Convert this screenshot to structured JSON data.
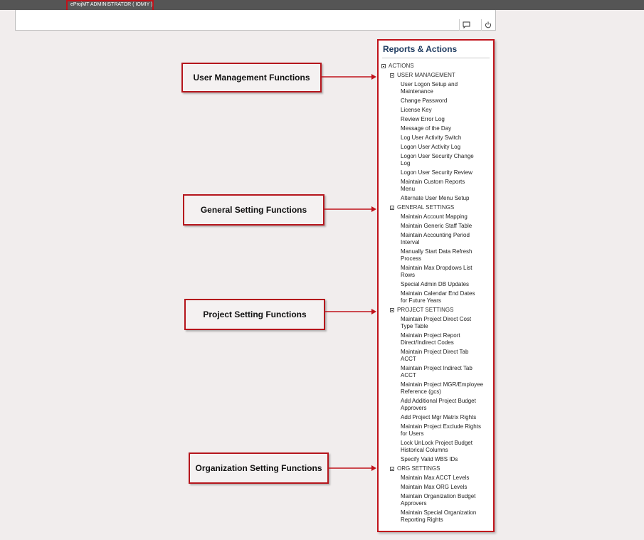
{
  "header": {
    "user_label": "eProjMT ADMINISTRATOR ( IOMIY )",
    "icons": [
      "chat-icon",
      "power-icon"
    ]
  },
  "callouts": [
    {
      "id": "user-management",
      "label": "User Management Functions"
    },
    {
      "id": "general-setting",
      "label": "General Setting Functions"
    },
    {
      "id": "project-setting",
      "label": "Project Setting Functions"
    },
    {
      "id": "organization-setting",
      "label": "Organization Setting Functions"
    }
  ],
  "panel": {
    "title": "Reports & Actions",
    "root": "ACTIONS",
    "sections": [
      {
        "label": "USER MANAGEMENT",
        "items": [
          [
            "User Logon Setup and",
            "Maintenance"
          ],
          [
            "Change Password"
          ],
          [
            "License Key"
          ],
          [
            "Review Error Log"
          ],
          [
            "Message of the Day"
          ],
          [
            "Log User Activity Switch"
          ],
          [
            "Logon User Activity Log"
          ],
          [
            "Logon User Security Change",
            "Log"
          ],
          [
            "Logon User Security Review"
          ],
          [
            "Maintain Custom Reports",
            "Menu"
          ],
          [
            "Alternate User Menu Setup"
          ]
        ]
      },
      {
        "label": "GENERAL SETTINGS",
        "items": [
          [
            "Maintain Account Mapping"
          ],
          [
            "Maintain Generic Staff Table"
          ],
          [
            "Maintain Accounting Period",
            "Interval"
          ],
          [
            "Manually Start Data Refresh",
            "Process"
          ],
          [
            "Maintain Max Dropdows List",
            "Rows"
          ],
          [
            "Special Admin DB Updates"
          ],
          [
            "Maintain Calendar End Dates",
            "for Future Years"
          ]
        ]
      },
      {
        "label": "PROJECT SETTINGS",
        "items": [
          [
            "Maintain Project Direct Cost",
            "Type Table"
          ],
          [
            "Maintain Project Report",
            "Direct/Indirect Codes"
          ],
          [
            "Maintain Project Direct Tab",
            "ACCT"
          ],
          [
            "Maintain Project Indirect Tab",
            "ACCT"
          ],
          [
            "Maintain Project MGR/Employee",
            "Reference (gcs)"
          ],
          [
            "Add Additional Project Budget",
            "Approvers"
          ],
          [
            "Add Project Mgr Matrix Rights"
          ],
          [
            "Maintain Project Exclude Rights",
            "for Users"
          ],
          [
            "Lock UnLock Project Budget",
            "Historical Columns"
          ],
          [
            "Specify Valid WBS IDs"
          ]
        ]
      },
      {
        "label": "ORG SETTINGS",
        "items": [
          [
            "Maintain Max ACCT Levels"
          ],
          [
            "Maintain Max ORG Levels"
          ],
          [
            "Maintain Organization Budget",
            "Approvers"
          ],
          [
            "Maintain Special Organization",
            "Reporting Rights"
          ]
        ]
      }
    ]
  },
  "colors": {
    "highlight_border": "#c0131b",
    "title_text": "#1e3a5f",
    "background": "#f1eded"
  }
}
